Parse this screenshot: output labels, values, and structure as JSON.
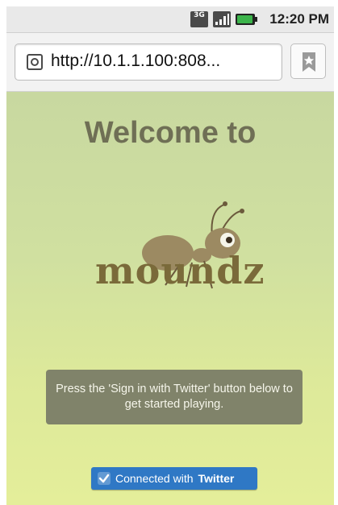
{
  "status_bar": {
    "network_label": "3G",
    "time": "12:20 PM",
    "icons": [
      "3g-icon",
      "signal-icon",
      "battery-icon"
    ]
  },
  "browser": {
    "url": "http://10.1.1.100:808...",
    "bookmark_icon": "bookmark-star-icon"
  },
  "page": {
    "welcome_text": "Welcome to",
    "logo_text": "moundz",
    "instruction_text": "Press the 'Sign in with Twitter' button below to get started playing.",
    "twitter_button": {
      "prefix": "Connected with",
      "brand": "Twitter"
    }
  },
  "colors": {
    "gradient_top": "#c8d8a0",
    "gradient_bottom": "#e4ee9a",
    "twitter_blue": "#2f78c5",
    "instruction_bg": "#80836a"
  }
}
